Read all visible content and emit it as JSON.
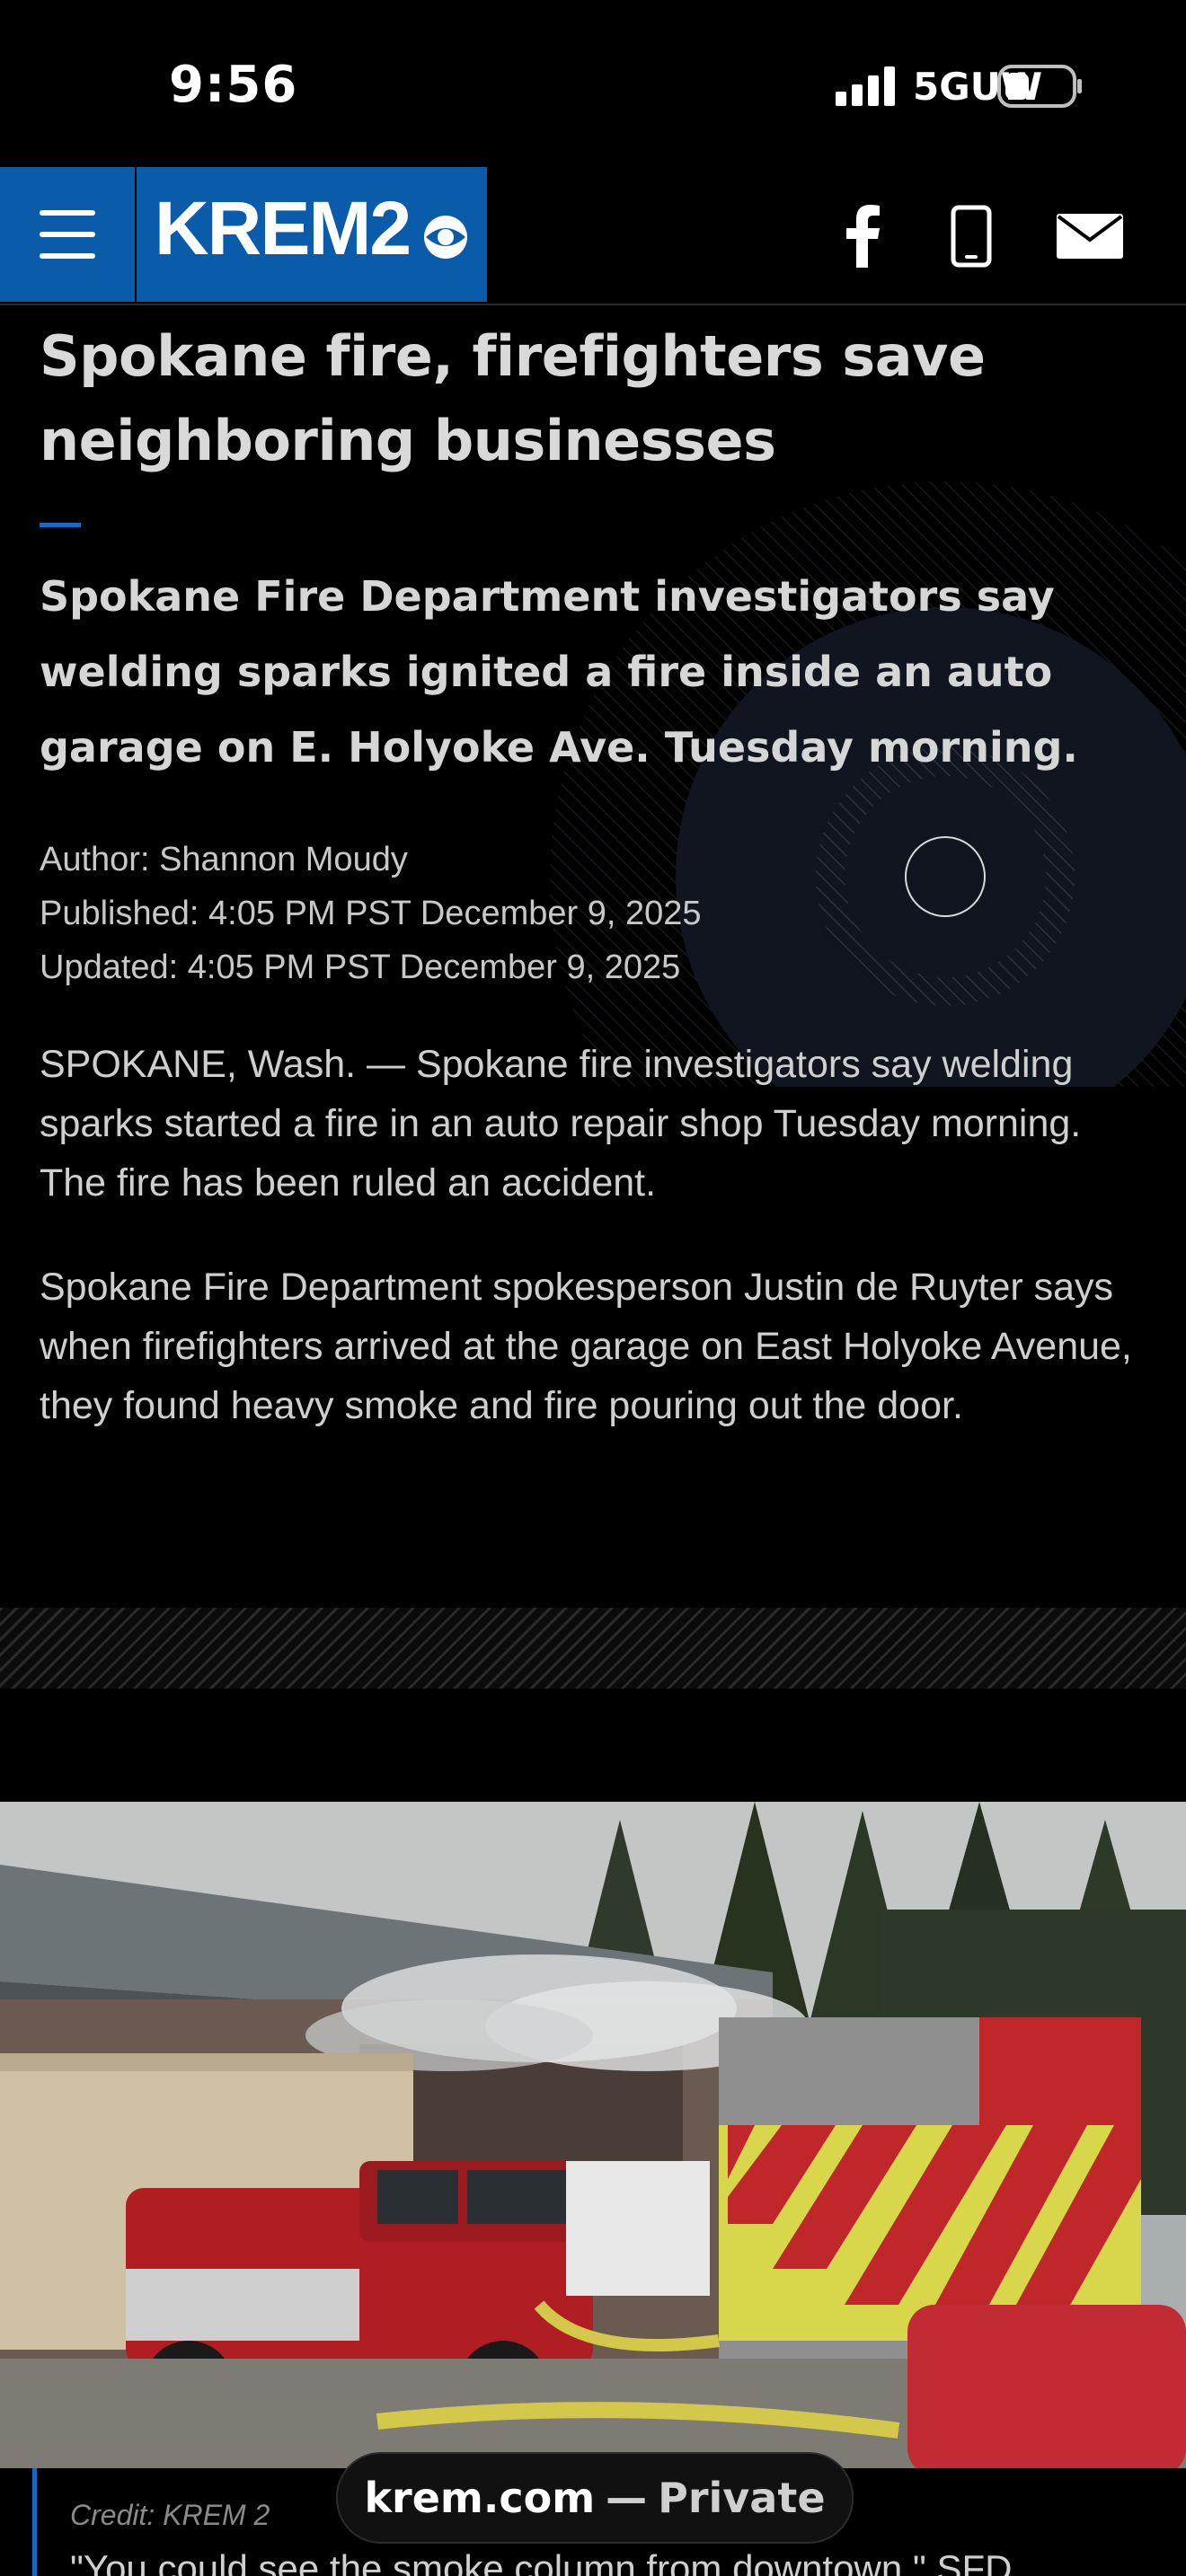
{
  "status_bar": {
    "time": "9:56",
    "network": "5GUW",
    "icons": [
      "signal-bars-icon",
      "battery-icon"
    ]
  },
  "nav": {
    "logo_text": "KREM2",
    "logo_icon": "cbs-eye-icon",
    "menu_icon": "hamburger-menu-icon",
    "social_icons": [
      "facebook-icon",
      "mobile-phone-icon",
      "mail-icon"
    ],
    "brand_color": "#0a5cab"
  },
  "article": {
    "headline": "Spokane fire, firefighters save neighboring businesses",
    "summary": "Spokane Fire Department investigators say welding sparks ignited a fire inside an auto garage on E. Holyoke Ave. Tuesday morning.",
    "author": "Author: Shannon Moudy",
    "published": "Published: 4:05 PM PST December 9, 2025",
    "updated": "Updated: 4:05 PM PST December 9, 2025",
    "paragraphs": [
      "SPOKANE, Wash. — Spokane fire investigators say welding sparks started a fire in an auto repair shop Tuesday morning. The fire has been ruled an accident.",
      "Spokane Fire Department spokesperson Justin de Ruyter says when firefighters arrived at the garage on East Holyoke Avenue, they found heavy smoke and fire pouring out the door."
    ],
    "photo": {
      "credit": "Credit: KREM 2",
      "alt_subject": "fire-scene-photo"
    },
    "next_quote_peek": "\"You could see the smoke column from downtown,\" SFD"
  },
  "browser": {
    "domain": "krem.com",
    "separator": "—",
    "mode": "Private"
  },
  "accent_color": "#1769c4"
}
